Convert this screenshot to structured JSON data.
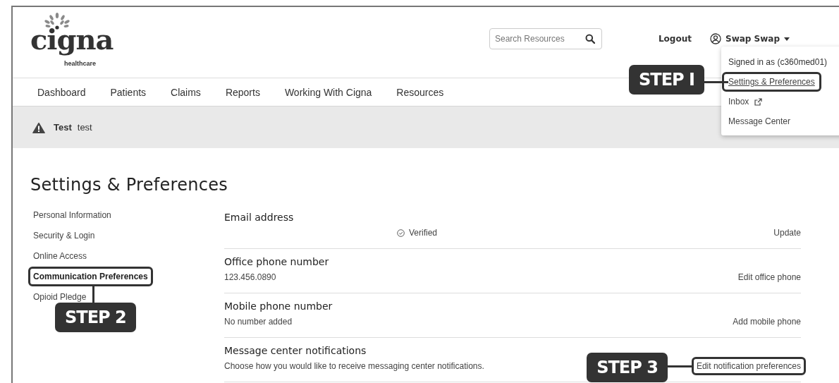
{
  "logo": {
    "wordmark": "cigna",
    "tagline": "healthcare"
  },
  "search": {
    "placeholder": "Search Resources"
  },
  "logout": "Logout",
  "user": {
    "name": "Swap Swap"
  },
  "user_menu": [
    {
      "kind": "info",
      "label": "Signed in as (c360med01)"
    },
    {
      "kind": "link",
      "label": "Settings & Preferences",
      "highlighted": true,
      "callout": "STEP I"
    },
    {
      "kind": "external",
      "label": "Inbox",
      "highlighted": false
    },
    {
      "kind": "link",
      "label": "Message Center",
      "highlighted": false
    }
  ],
  "nav": [
    "Dashboard",
    "Patients",
    "Claims",
    "Reports",
    "Working With Cigna",
    "Resources"
  ],
  "alert": {
    "title": "Test",
    "message": "test"
  },
  "page_title": "Settings & Preferences",
  "sidebar": [
    {
      "label": "Personal Information",
      "selected": false,
      "highlighted": false
    },
    {
      "label": "Security & Login",
      "selected": false,
      "highlighted": false
    },
    {
      "label": "Online Access",
      "selected": false,
      "highlighted": false
    },
    {
      "label": "Communication Preferences",
      "selected": true,
      "highlighted": true,
      "callout": "STEP 2"
    },
    {
      "label": "Opioid Pledge",
      "selected": false,
      "highlighted": false
    }
  ],
  "rows": [
    {
      "title": "Email address",
      "status": "Verified",
      "action": "Update",
      "highlighted": false
    },
    {
      "title": "Office phone number",
      "detail": "123.456.0890",
      "action": "Edit office phone",
      "highlighted": false
    },
    {
      "title": "Mobile phone number",
      "detail": "No number added",
      "action": "Add mobile phone",
      "highlighted": false
    },
    {
      "title": "Message center notifications",
      "detail": "Choose how you would like to receive messaging center notifications.",
      "action": "Edit notification preferences",
      "highlighted": true,
      "callout": "STEP 3"
    }
  ]
}
